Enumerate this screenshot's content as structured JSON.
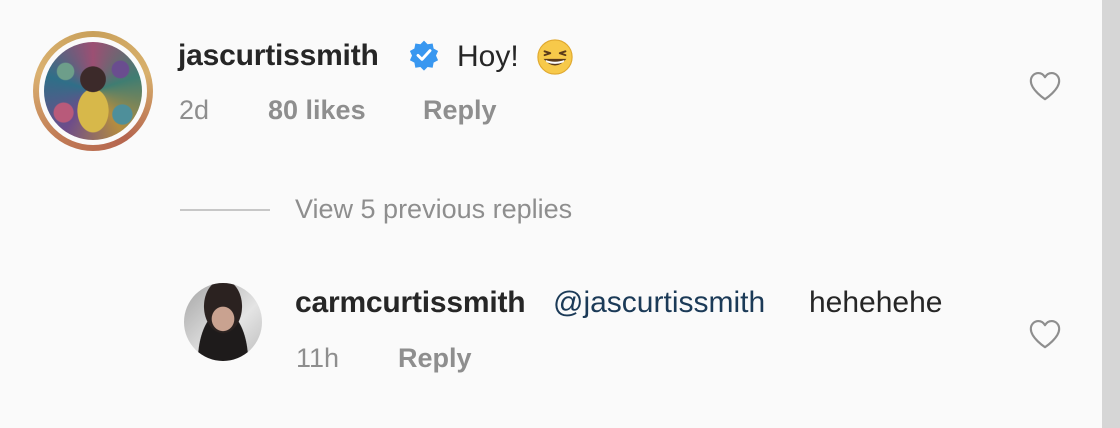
{
  "comments": [
    {
      "username": "jascurtissmith",
      "verified": true,
      "text": "Hoy!",
      "emoji": "grinning-squinting-face",
      "time": "2d",
      "likes": "80 likes",
      "reply": "Reply"
    }
  ],
  "view_replies": "View 5 previous replies",
  "replies": [
    {
      "username": "carmcurtissmith",
      "mention": "@jascurtissmith",
      "text": "hehehehe",
      "time": "11h",
      "reply": "Reply"
    }
  ],
  "colors": {
    "text": "#262626",
    "muted": "#8e8e8e",
    "mention": "#1b3a57",
    "verified": "#3897f0"
  },
  "icons": {
    "like": "heart-outline-icon",
    "verified": "verified-badge-icon"
  }
}
